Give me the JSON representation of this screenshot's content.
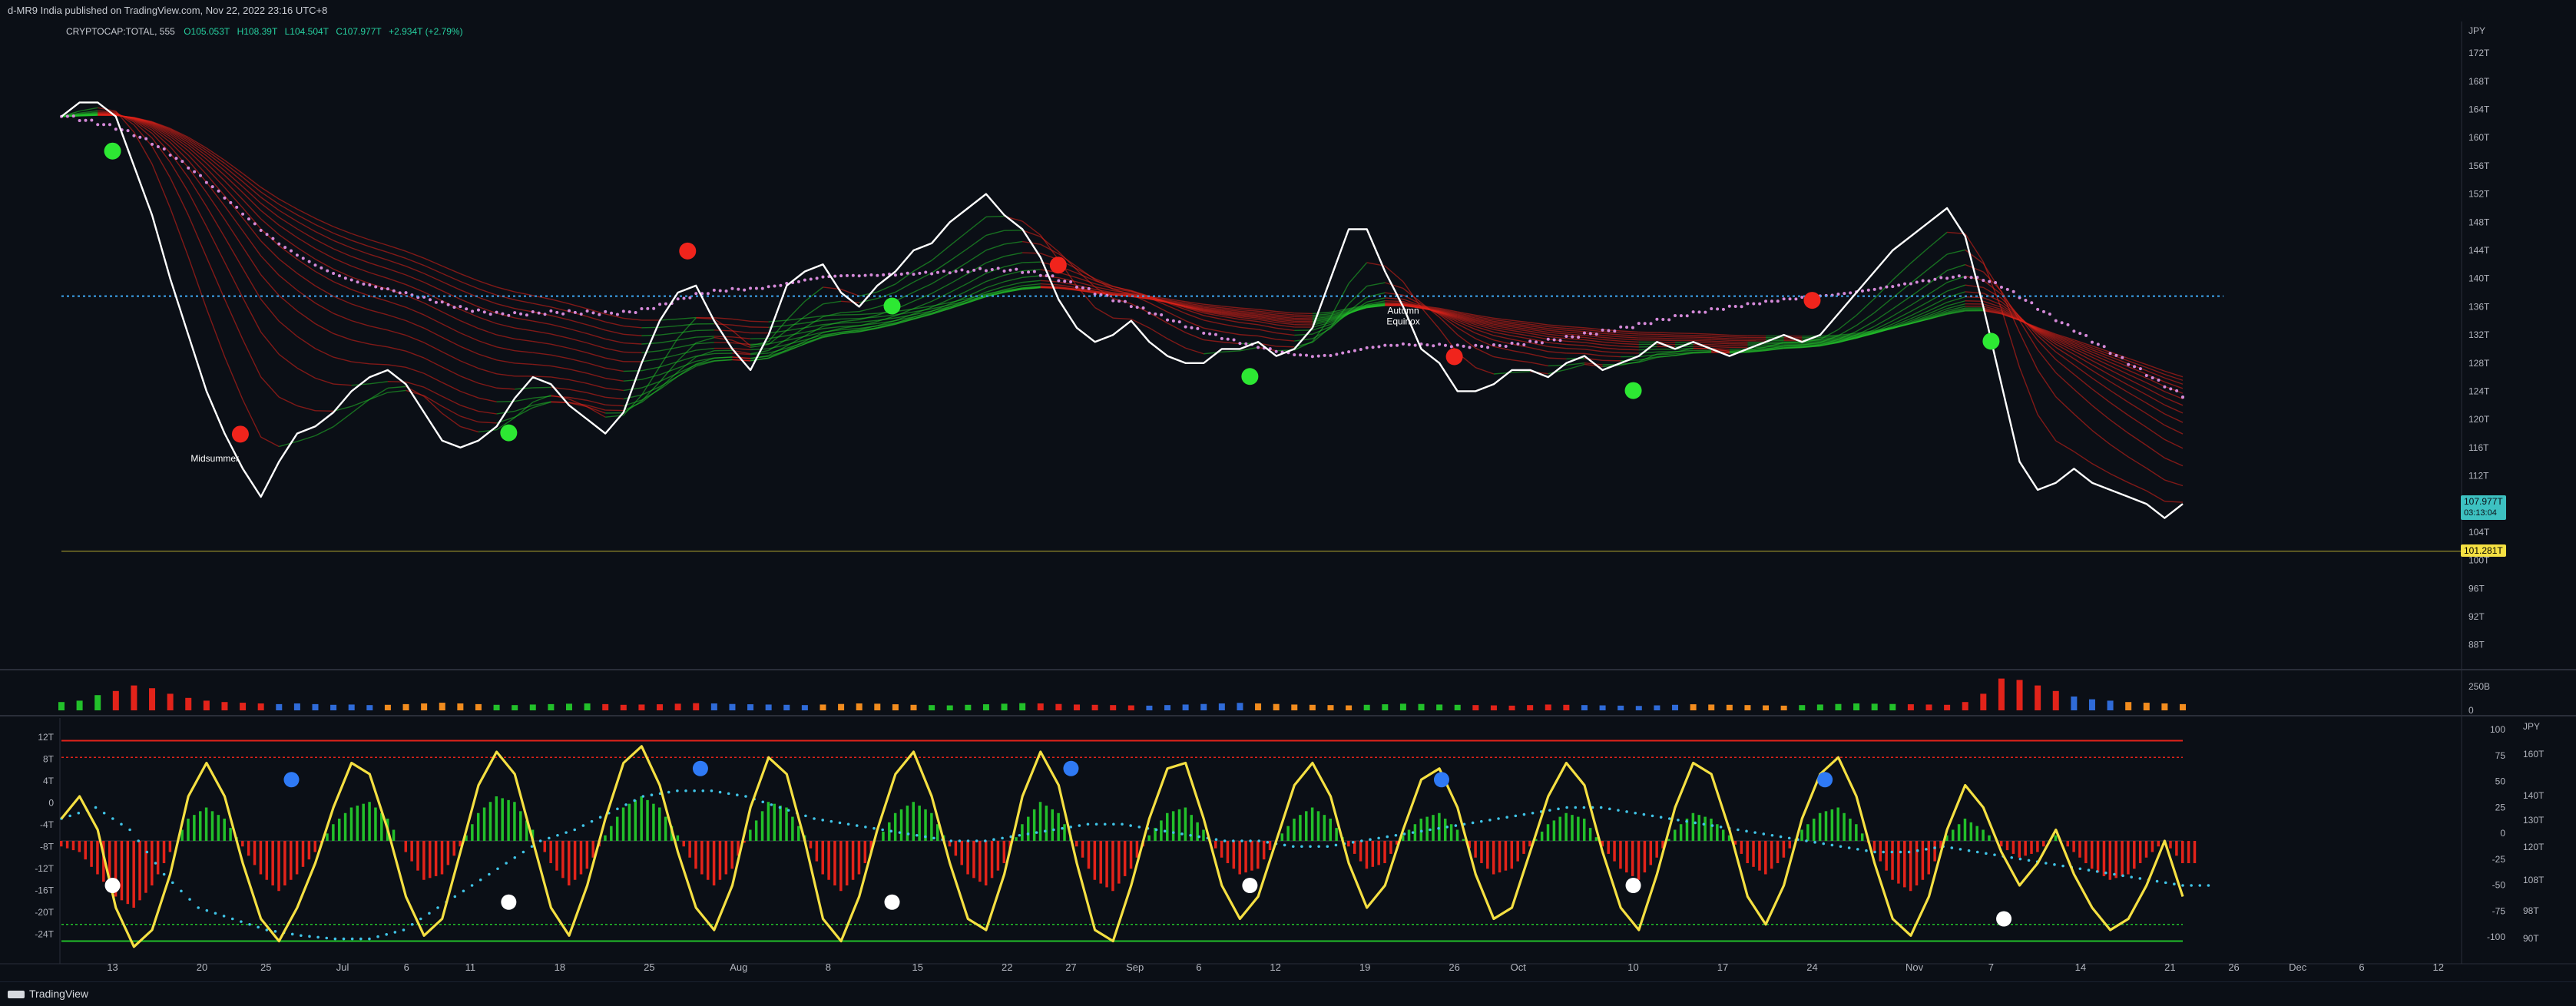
{
  "header": {
    "published_line": "d-MR9 India published on TradingView.com, Nov 22, 2022 23:16 UTC+8",
    "symbol": "CRYPTOCAP:TOTAL, 555",
    "open": "O105.053T",
    "high": "H108.39T",
    "low": "L104.504T",
    "close": "C107.977T",
    "change": "+2.934T (+2.79%)"
  },
  "price_axis": {
    "currency": "JPY",
    "ticks": [
      "172T",
      "168T",
      "164T",
      "160T",
      "156T",
      "152T",
      "148T",
      "144T",
      "140T",
      "136T",
      "132T",
      "128T",
      "124T",
      "120T",
      "116T",
      "112T",
      "108T",
      "104T",
      "100T",
      "96T",
      "92T",
      "88T"
    ],
    "last_price": "107.977T",
    "countdown": "03:13:04",
    "marked_level": "101.281T"
  },
  "volume_axis": {
    "ticks": [
      "250B",
      "0"
    ]
  },
  "osc_axes": {
    "left_ticks": [
      "12T",
      "8T",
      "4T",
      "0",
      "-4T",
      "-8T",
      "-12T",
      "-16T",
      "-20T",
      "-24T"
    ],
    "mid_ticks": [
      "100",
      "75",
      "50",
      "25",
      "0",
      "-25",
      "-50",
      "-75",
      "-100"
    ],
    "right_currency": "JPY",
    "right_ticks": [
      "160T",
      "140T",
      "130T",
      "120T",
      "108T",
      "98T",
      "90T"
    ]
  },
  "time_axis": {
    "labels": [
      "13",
      "20",
      "25",
      "Jul",
      "6",
      "11",
      "18",
      "25",
      "Aug",
      "8",
      "15",
      "22",
      "27",
      "Sep",
      "6",
      "12",
      "19",
      "26",
      "Oct",
      "10",
      "17",
      "24",
      "Nov",
      "7",
      "14",
      "21",
      "26",
      "Dec",
      "6",
      "12"
    ]
  },
  "annotations": {
    "label_a": "Midsummer",
    "label_b1": "Autumn",
    "label_b2": "Equinox"
  },
  "footer": {
    "brand": "TradingView"
  },
  "colors": {
    "bull": "#22c02a",
    "bear": "#e2231a",
    "price_line": "#ffffff",
    "osc_line": "#f5e042",
    "signal_line": "#3fc3e6",
    "ma_dots": "#d58ad9",
    "level_line": "#3fa9f5"
  },
  "chart_data": [
    {
      "type": "line",
      "title": "",
      "ylabel": "JPY",
      "ylim": [
        86,
        173
      ],
      "x_range": [
        "Jun 9",
        "Nov 22"
      ],
      "hline_levels": [
        137.5,
        101.281
      ],
      "series": [
        {
          "values": [
            163,
            165,
            165,
            163,
            156,
            149,
            140,
            132,
            124,
            118,
            113,
            109,
            114,
            118,
            119,
            121,
            124,
            126,
            127,
            125,
            121,
            117,
            116,
            117,
            119,
            123,
            126,
            125,
            122,
            120,
            118,
            121,
            128,
            134,
            138,
            139,
            134,
            130,
            127,
            132,
            139,
            141,
            142,
            138,
            136,
            139,
            141,
            144,
            145,
            148,
            150,
            152,
            149,
            147,
            143,
            137,
            133,
            131,
            132,
            134,
            131,
            129,
            128,
            128,
            130,
            130,
            131,
            129,
            130,
            133,
            140,
            147,
            147,
            141,
            136,
            130,
            128,
            124,
            124,
            125,
            127,
            127,
            126,
            128,
            129,
            127,
            128,
            129,
            131,
            130,
            131,
            130,
            129,
            130,
            131,
            132,
            131,
            132,
            135,
            138,
            141,
            144,
            146,
            148,
            150,
            146,
            136,
            125,
            114,
            110,
            111,
            113,
            111,
            110,
            109,
            108,
            106,
            108
          ]
        }
      ],
      "signals": [
        {
          "date": "Jun 13",
          "type": "buy"
        },
        {
          "date": "Jun 23",
          "type": "sell"
        },
        {
          "date": "Jul 14",
          "type": "buy"
        },
        {
          "date": "Jul 28",
          "type": "sell"
        },
        {
          "date": "Aug 13",
          "type": "buy"
        },
        {
          "date": "Aug 26",
          "type": "sell"
        },
        {
          "date": "Sep 10",
          "type": "buy"
        },
        {
          "date": "Sep 26",
          "type": "sell"
        },
        {
          "date": "Oct 10",
          "type": "buy"
        },
        {
          "date": "Oct 24",
          "type": "sell"
        },
        {
          "date": "Nov 7",
          "type": "buy"
        }
      ]
    },
    {
      "type": "bar",
      "title": "",
      "ylim": [
        0,
        250
      ],
      "values": [
        60,
        70,
        110,
        140,
        180,
        160,
        120,
        90,
        70,
        60,
        55,
        50,
        45,
        50,
        45,
        40,
        42,
        38,
        40,
        45,
        50,
        55,
        50,
        45,
        40,
        38,
        42,
        45,
        48,
        50,
        45,
        40,
        42,
        44,
        48,
        52,
        50,
        46,
        44,
        42,
        40,
        38,
        42,
        46,
        50,
        48,
        44,
        40,
        38,
        36,
        40,
        44,
        48,
        52,
        50,
        46,
        42,
        40,
        38,
        36,
        34,
        38,
        42,
        46,
        50,
        54,
        50,
        46,
        42,
        40,
        38,
        36,
        40,
        44,
        48,
        46,
        42,
        40,
        38,
        36,
        34,
        38,
        42,
        40,
        38,
        36,
        34,
        32,
        36,
        40,
        44,
        42,
        40,
        38,
        36,
        34,
        38,
        42,
        46,
        50,
        48,
        46,
        44,
        42,
        40,
        60,
        120,
        230,
        220,
        180,
        140,
        100,
        80,
        70,
        60,
        55,
        50,
        45
      ]
    },
    {
      "type": "line",
      "title": "",
      "ylim": [
        -100,
        100
      ],
      "series": [
        {
          "values": [
            20,
            40,
            10,
            -60,
            -95,
            -80,
            -30,
            40,
            70,
            40,
            -20,
            -70,
            -90,
            -60,
            -20,
            30,
            70,
            60,
            10,
            -50,
            -85,
            -70,
            -10,
            50,
            80,
            60,
            0,
            -60,
            -85,
            -40,
            20,
            70,
            85,
            50,
            -10,
            -60,
            -80,
            -40,
            30,
            75,
            60,
            0,
            -70,
            -90,
            -50,
            10,
            60,
            80,
            40,
            -20,
            -70,
            -80,
            -30,
            40,
            80,
            50,
            -20,
            -80,
            -90,
            -40,
            20,
            65,
            70,
            20,
            -40,
            -70,
            -50,
            0,
            50,
            70,
            40,
            -20,
            -60,
            -40,
            10,
            55,
            65,
            30,
            -30,
            -70,
            -60,
            -10,
            40,
            70,
            50,
            -10,
            -60,
            -80,
            -30,
            30,
            70,
            60,
            10,
            -50,
            -75,
            -40,
            20,
            60,
            75,
            40,
            -20,
            -70,
            -85,
            -50,
            10,
            50,
            30,
            -10,
            -40,
            -20,
            10,
            -30,
            -60,
            -80,
            -70,
            -40,
            0,
            -50
          ]
        },
        {
          "values": [
            20,
            30,
            10,
            -30,
            -60,
            -70,
            -80,
            -85,
            -88,
            -88,
            -80,
            -60,
            -40,
            -20,
            0,
            10,
            25,
            40,
            45,
            45,
            40,
            30,
            20,
            15,
            10,
            5,
            0,
            0,
            5,
            10,
            15,
            15,
            10,
            5,
            0,
            0,
            -5,
            -5,
            0,
            5,
            10,
            15,
            20,
            25,
            30,
            30,
            25,
            20,
            15,
            10,
            5,
            0,
            -5,
            -10,
            -10,
            -5,
            -10,
            -15,
            -20,
            -25,
            -30,
            -35,
            -40
          ]
        },
        {
          "values": [
            -5,
            -10,
            -30,
            -50,
            -60,
            -40,
            -10,
            20,
            30,
            20,
            -5,
            -30,
            -45,
            -30,
            -10,
            15,
            30,
            35,
            20,
            -10,
            -35,
            -30,
            -5,
            25,
            40,
            35,
            10,
            -20,
            -40,
            -25,
            5,
            30,
            40,
            30,
            5,
            -25,
            -40,
            -25,
            10,
            35,
            30,
            5,
            -30,
            -45,
            -30,
            0,
            25,
            35,
            25,
            -5,
            -30,
            -40,
            -20,
            15,
            35,
            25,
            -5,
            -35,
            -45,
            -25,
            5,
            25,
            30,
            10,
            -15,
            -30,
            -25,
            0,
            20,
            30,
            20,
            -5,
            -25,
            -20,
            5,
            20,
            25,
            10,
            -15,
            -30,
            -25,
            -5,
            15,
            25,
            20,
            -5,
            -25,
            -35,
            -15,
            10,
            25,
            20,
            5,
            -20,
            -30,
            -15,
            10,
            25,
            30,
            15,
            -10,
            -35,
            -45,
            -30,
            5,
            20,
            10,
            -5,
            -15,
            -10,
            5,
            -10,
            -25,
            -35,
            -30,
            -15,
            0,
            -20
          ]
        }
      ],
      "levels": [
        -90,
        -75,
        75,
        90
      ],
      "signals": [
        {
          "date": "Jun 13",
          "type": "oversold"
        },
        {
          "date": "Jun 27",
          "type": "overbought"
        },
        {
          "date": "Jul 14",
          "type": "oversold"
        },
        {
          "date": "Jul 29",
          "type": "overbought"
        },
        {
          "date": "Aug 13",
          "type": "oversold"
        },
        {
          "date": "Aug 27",
          "type": "overbought"
        },
        {
          "date": "Sep 10",
          "type": "oversold"
        },
        {
          "date": "Sep 25",
          "type": "overbought"
        },
        {
          "date": "Oct 10",
          "type": "oversold"
        },
        {
          "date": "Oct 25",
          "type": "overbought"
        },
        {
          "date": "Nov 8",
          "type": "oversold"
        }
      ]
    }
  ]
}
